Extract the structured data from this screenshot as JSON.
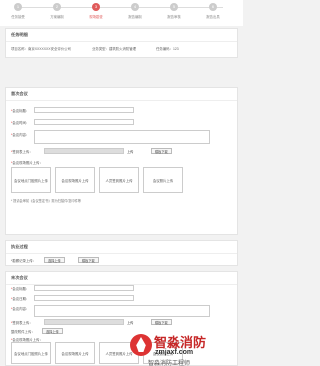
{
  "steps": [
    {
      "label": "任务接受"
    },
    {
      "label": "方案编制"
    },
    {
      "label": "现场勘查"
    },
    {
      "label": "报告编制"
    },
    {
      "label": "报告审核"
    },
    {
      "label": "报告出具"
    }
  ],
  "task_info": {
    "title": "任务明细",
    "project_name": "项目名称：南京XXXXXXX安全评价公司",
    "business_type": "业务类型：建筑防火消防管理",
    "project_code": "任务编码：123"
  },
  "first_meeting": {
    "title": "首次会议",
    "meeting_title_label": "会议标题：",
    "meeting_time_label": "会议时间：",
    "meeting_content_label": "会议内容：",
    "sign_table_label": "签到表上传：",
    "upload_btn": "上传",
    "template_btn": "模板下载",
    "photo_label": "会议现场照片上传：",
    "photos": [
      "会议地点门脸照片上传",
      "会议现场照片上传",
      "人员签到照片上传",
      "会议照片上传"
    ],
    "note": "* 提请会审前《会议签定书》需为扫描件/复印件等"
  },
  "execution": {
    "title": "执业过程",
    "upload_label": "*勘察记录上传：",
    "upload_btn": "选择上传",
    "template_btn": "模板下载"
  },
  "last_meeting": {
    "title": "末次会议",
    "meeting_title_label": "会议标题：",
    "meeting_time_label": "会议日期：",
    "meeting_content_label": "会议内容：",
    "sign_table_label": "签到表上传：",
    "upload_btn": "上传",
    "template_btn": "模板下载",
    "rectify_label": "整改附件上传：",
    "rectify_btn": "选择上传",
    "photo_label": "会议现场照片上传：",
    "photos": [
      "会议地点门脸照片上传",
      "会议现场照片上传",
      "人员签到照片上传",
      "会议照片上传"
    ]
  },
  "watermark": {
    "brand_cn": "智淼消防",
    "brand_url": "zmjaxf.com",
    "sub": "智淼消防工程师"
  }
}
